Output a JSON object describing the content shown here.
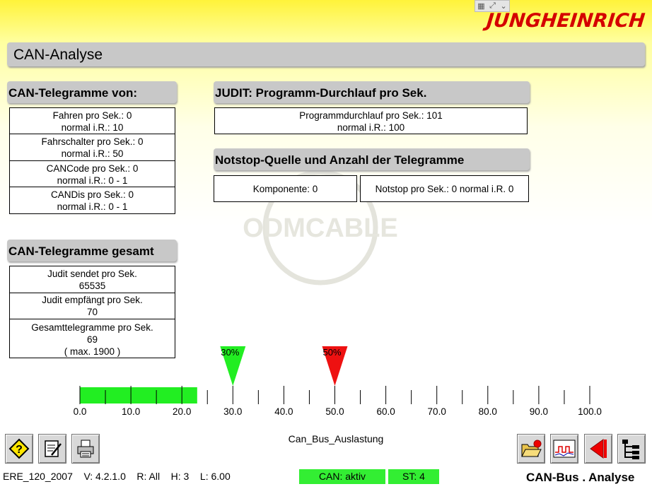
{
  "brand": {
    "logo_text": "JUNGHEINRICH"
  },
  "window": {
    "title": "CAN-Analyse",
    "ctrl_icons": [
      "grid-icon",
      "expand-icon",
      "chevron-down-icon"
    ]
  },
  "can_telegramme_von": {
    "header": "CAN-Telegramme von:",
    "rows": [
      {
        "line1": "Fahren pro Sek.:  0",
        "line2": "normal i.R.:  10"
      },
      {
        "line1": "Fahrschalter pro Sek.:  0",
        "line2": "normal i.R.:  50"
      },
      {
        "line1": "CANCode pro Sek.:  0",
        "line2": "normal i.R.:  0 - 1"
      },
      {
        "line1": "CANDis pro Sek.:  0",
        "line2": "normal i.R.:  0 - 1"
      }
    ]
  },
  "judit": {
    "header": "JUDIT:  Programm-Durchlauf pro Sek.",
    "line1": "Programmdurchlauf pro Sek.:  101",
    "line2": "normal i.R.:  100"
  },
  "notstop": {
    "header": "Notstop-Quelle und Anzahl der Telegramme",
    "komponente": "Komponente: 0",
    "notstop_text": "Notstop pro Sek.: 0 normal i.R. 0"
  },
  "can_telegramme_gesamt": {
    "header": "CAN-Telegramme gesamt",
    "rows": [
      {
        "line1": "Judit sendet pro Sek.",
        "line2": "65535",
        "line3": ""
      },
      {
        "line1": "Judit empfängt pro Sek.",
        "line2": "70",
        "line3": ""
      },
      {
        "line1": "Gesamttelegramme pro Sek.",
        "line2": "69",
        "line3": "(  max. 1900 )"
      }
    ]
  },
  "bus_load": {
    "label": "Can_Bus_Auslastung",
    "value": 23,
    "scale_min": 0,
    "scale_max": 100,
    "tick_labels": [
      "0.0",
      "10.0",
      "20.0",
      "30.0",
      "40.0",
      "50.0",
      "60.0",
      "70.0",
      "80.0",
      "90.0",
      "100.0"
    ],
    "markers": [
      {
        "label": "30%",
        "value": 30,
        "color": "#22ee22"
      },
      {
        "label": "50%",
        "value": 50,
        "color": "#ee1111"
      }
    ],
    "bar_color": "#22ee22"
  },
  "toolbar_left": [
    {
      "name": "help-button",
      "icon": "help-diamond-icon"
    },
    {
      "name": "notes-button",
      "icon": "notepad-icon"
    },
    {
      "name": "print-button",
      "icon": "printer-icon"
    }
  ],
  "toolbar_right": [
    {
      "name": "open-folder-button",
      "icon": "folder-open-icon"
    },
    {
      "name": "chart-button",
      "icon": "oscilloscope-icon"
    },
    {
      "name": "back-button",
      "icon": "arrow-left-icon"
    },
    {
      "name": "tree-button",
      "icon": "tree-structure-icon"
    }
  ],
  "status": {
    "model": "ERE_120_2007",
    "version": "V: 4.2.1.0",
    "r": "R: All",
    "h": "H: 3",
    "l": "L: 6.00",
    "can": "CAN: aktiv",
    "st": "ST: 4",
    "screen_name": "CAN-Bus . Analyse"
  },
  "watermark": {
    "text": "ODMCABLE"
  }
}
